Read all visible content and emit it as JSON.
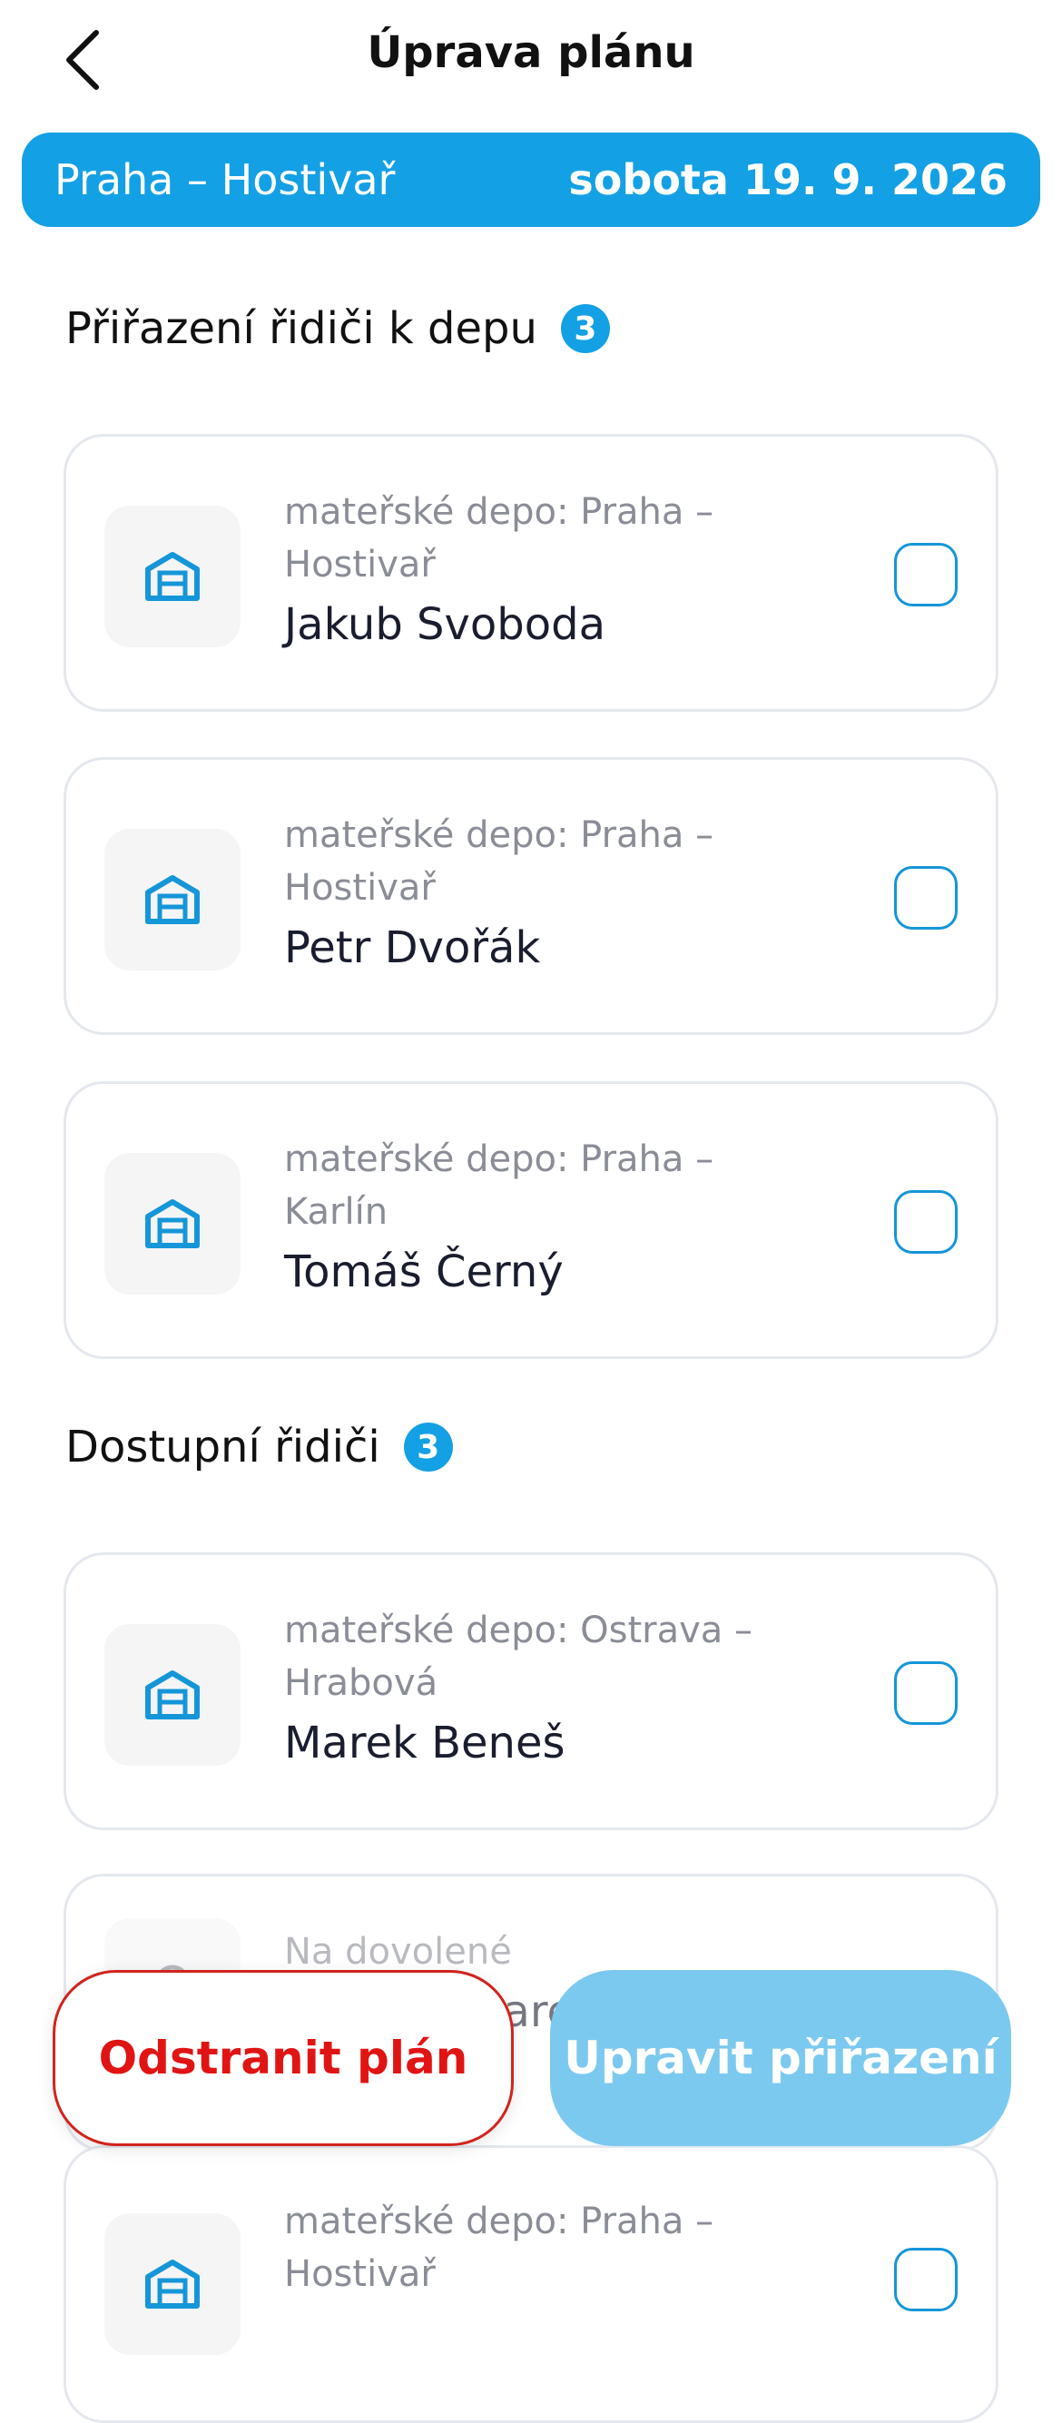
{
  "header": {
    "title": "Úprava plánu"
  },
  "banner": {
    "depot": "Praha – Hostivař",
    "date": "sobota 19. 9. 2026"
  },
  "assigned": {
    "title": "Přiřazení řidiči k depu",
    "count": "3",
    "drivers": [
      {
        "depot": "mateřské depo: Praha – Hostivař",
        "name": "Jakub Svoboda",
        "checked": false
      },
      {
        "depot": "mateřské depo: Praha – Hostivař",
        "name": "Petr Dvořák",
        "checked": false
      },
      {
        "depot": "mateřské depo: Praha – Karlín",
        "name": "Tomáš Černý",
        "checked": false
      }
    ]
  },
  "available": {
    "title": "Dostupní řidiči",
    "count": "3",
    "drivers": [
      {
        "depot": "mateřské depo: Ostrava – Hrabová",
        "name": "Marek Beneš",
        "checked": false
      },
      {
        "depot": "Na dovolené",
        "name": "Maresová",
        "checked": false
      },
      {
        "depot": "mateřské depo: Praha – Hostivař",
        "name": "",
        "checked": false
      }
    ]
  },
  "actions": {
    "delete_label": "Odstranit plán",
    "edit_label": "Upravit přiřazení"
  },
  "colors": {
    "accent": "#14a0e4",
    "danger": "#e11414",
    "edit_button": "#7cc9ef"
  },
  "icons": {
    "back": "chevron-left-icon",
    "depot": "garage-icon",
    "vacation": "pin-icon"
  }
}
